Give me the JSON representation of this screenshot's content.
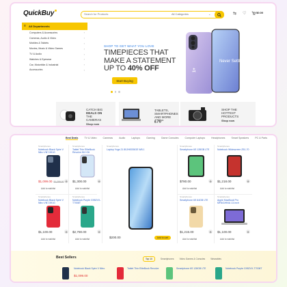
{
  "header": {
    "logo": "QuickBuy",
    "search_placeholder": "Search for Products",
    "search_category": "All Categories",
    "cart_total": "$0.00"
  },
  "sidebar": {
    "all_departments": "All Departments",
    "items": [
      {
        "label": "Computers & Accessories"
      },
      {
        "label": "Cameras, Audio & Video"
      },
      {
        "label": "Mobiles & Tablets"
      },
      {
        "label": "Movies, Music & Video Games"
      },
      {
        "label": "TV & Audio"
      },
      {
        "label": "Watches & Eyewear"
      },
      {
        "label": "Car, Motorbike & Industrial"
      },
      {
        "label": "Accessories"
      }
    ]
  },
  "hero": {
    "tag": "SHOP TO GET WHAT YOU LOVE",
    "line1": "TIMEPIECES THAT",
    "line2": "MAKE A STATEMENT",
    "line3a": "UP TO ",
    "line3b": "40% OFF",
    "button": "Start Buying",
    "phone_label": "Never Settle"
  },
  "promos": [
    {
      "line1": "CATCH BIG",
      "line2": "DEALS ON",
      "line3": "THE",
      "line4": "CAMERAS",
      "cta": "Shop now"
    },
    {
      "line1": "TABLETS,",
      "line2": "SMARTPHONES",
      "line3": "AND MORE",
      "price": "£70",
      "sup": "99"
    },
    {
      "line1": "SHOP THE",
      "line2": "HOTTEST",
      "line3": "PRODUCTS",
      "cta": "Shop now"
    }
  ],
  "tabs": [
    "Best Deals",
    "TV & Video",
    "Cameras",
    "Audio",
    "Laptops",
    "Gaming",
    "Game Consoles",
    "Computer Laptops",
    "Headphones",
    "Smart Speakers",
    "PC & Parts"
  ],
  "products": [
    {
      "cat": "Smartphones",
      "name": "Notebook Black Spire V Nitro VN7-591G",
      "price": "$1,099.00",
      "old": "$1,299.00",
      "red": true
    },
    {
      "cat": "Smartphones",
      "name": "Tablet Thin EliteBook Revolve 810 G6",
      "price": "$1,300.00",
      "old": "",
      "red": false
    },
    {
      "cat": "Smartphones",
      "name": "Laptop Yoga 21 80JH0035GE W8.1",
      "price": "$200.00",
      "old": "",
      "red": false
    },
    {
      "cat": "Smartphones",
      "name": "Smartphone 6S 128GB LTE",
      "price": "$780.00",
      "old": "",
      "red": false
    },
    {
      "cat": "Smartphones",
      "name": "Notebook Widescreen Z51-70",
      "price": "$1,218.00",
      "old": "",
      "red": false
    },
    {
      "cat": "Smartphones",
      "name": "Notebook Black Spire V Nitro VN7-591G",
      "price": "$1,100.00",
      "old": "",
      "red": false
    },
    {
      "cat": "Smartphones",
      "name": "Notebook Purple G952VX-T7008T",
      "price": "$2,780.00",
      "old": "",
      "red": false
    },
    {
      "cat": "Smartphones",
      "name": "Smartphone 6S 64GB LTE",
      "price": "$1,215.00",
      "old": "",
      "red": false
    },
    {
      "cat": "Smartphones",
      "name": "Apple MacBook Pro MF841HN/A 13-Inch",
      "price": "$1,100.00",
      "old": "",
      "red": false
    }
  ],
  "add_to_wishlist": "Add to wishlist",
  "add_to_cart": "Add to cart",
  "best_sellers": {
    "title": "Best Sellers",
    "tabs": [
      "Top 10",
      "Smartphones",
      "Video Games & Consoles",
      "Wearables"
    ],
    "items": [
      {
        "name": "Notebook Black Spire V Nitro",
        "price": "$1,099.00"
      },
      {
        "name": "Tablet Thin EliteBook Revolve"
      },
      {
        "name": "Smartphone 6S 128GB LTE"
      },
      {
        "name": "Notebook Purple G952VX-T7008T"
      }
    ]
  },
  "colors": {
    "accent": "#f7c600",
    "link": "#2a5fc9",
    "sale": "#e03131"
  }
}
